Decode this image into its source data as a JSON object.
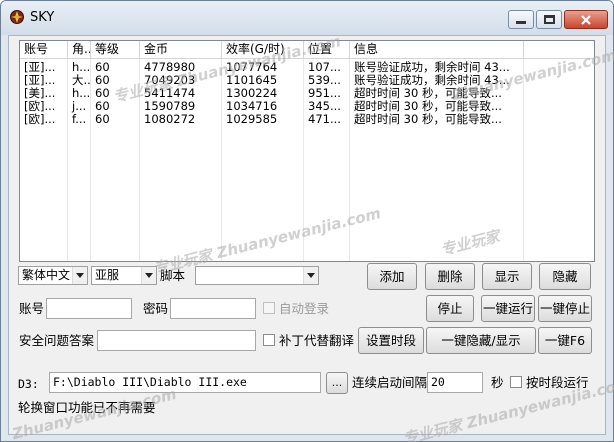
{
  "window": {
    "title": "SKY"
  },
  "colors": {
    "titlebar_top": "#e9eff6",
    "titlebar_bottom": "#d2dde9",
    "close_button": "#c9462c",
    "client_background": "#f0f0f0"
  },
  "list": {
    "columns": [
      "账号",
      "角...",
      "等级",
      "金币",
      "效率(G/时)",
      "位置",
      "信息"
    ],
    "rows": [
      [
        "[亚]...",
        "h...",
        "60",
        "4778980",
        "1077764",
        "107...",
        "账号验证成功，剩余时间 43..."
      ],
      [
        "[亚]...",
        "大...",
        "60",
        "7049203",
        "1101645",
        "539...",
        "账号验证成功，剩余时间 43..."
      ],
      [
        "[美]...",
        "h...",
        "60",
        "5411474",
        "1300224",
        "951...",
        "超时时间 30 秒，可能导致..."
      ],
      [
        "[欧]...",
        "j...",
        "60",
        "1590789",
        "1034716",
        "345...",
        "超时时间 30 秒，可能导致..."
      ],
      [
        "[欧]...",
        "f...",
        "60",
        "1080272",
        "1029585",
        "471...",
        "超时时间 30 秒，可能导致..."
      ]
    ]
  },
  "controls": {
    "language_select": "繁体中文",
    "server_select": "亚服",
    "script_label": "脚本",
    "script_select": "",
    "account_label": "账号",
    "account_value": "",
    "password_label": "密码",
    "password_value": "",
    "auto_login_label": "自动登录",
    "security_answer_label": "安全问题答案",
    "security_answer_value": "",
    "patch_translate_label": "补丁代替翻译",
    "set_time_button": "设置时段",
    "add_button": "添加",
    "delete_button": "删除",
    "show_button": "显示",
    "hide_button": "隐藏",
    "stop_button": "停止",
    "run_all_button": "一键运行",
    "stop_all_button": "一键停止",
    "hide_show_all_button": "一键隐藏/显示",
    "f6_all_button": "一键F6",
    "d3_label": "D3:",
    "d3_path": "F:\\Diablo III\\Diablo III.exe",
    "browse_button": "...",
    "launch_interval_label": "连续启动间隔",
    "launch_interval_value": "20",
    "seconds_label": "秒",
    "timed_run_label": "按时段运行",
    "status_text": "轮换窗口功能已不再需要"
  },
  "watermark": {
    "text": "Zhuanyewanjia.com",
    "cn": "专业玩家"
  }
}
